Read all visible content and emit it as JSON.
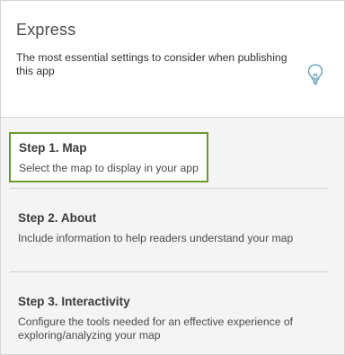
{
  "header": {
    "title": "Express",
    "description": "The most essential settings to consider when publishing this app",
    "icon": "lightbulb-icon"
  },
  "steps": [
    {
      "title": "Step 1. Map",
      "description": "Select the map to display in your app"
    },
    {
      "title": "Step 2. About",
      "description": "Include information to help readers understand your map"
    },
    {
      "title": "Step 3. Interactivity",
      "description": "Configure the tools needed for an effective experience of exploring/analyzing your map"
    }
  ],
  "colors": {
    "selected_border": "#6b9a2f",
    "icon": "#5a9ab5"
  }
}
